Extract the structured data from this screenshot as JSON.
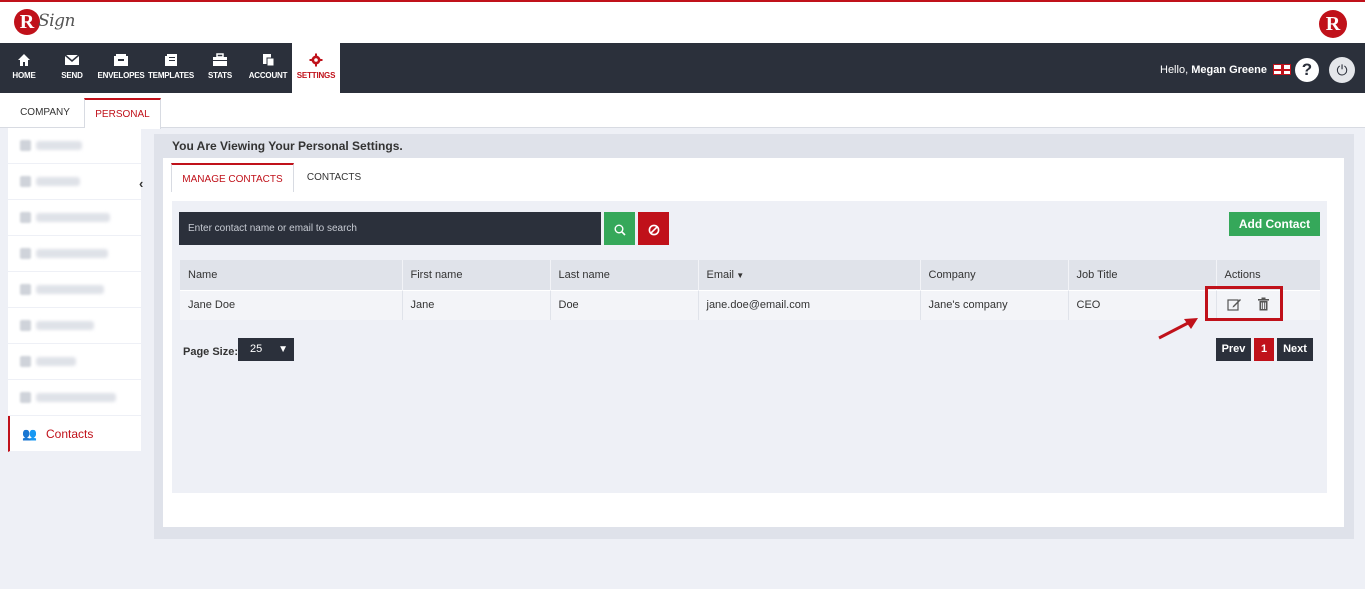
{
  "app": {
    "logo_letter": "R",
    "logo_word": "Sign",
    "right_logo_letter": "R"
  },
  "nav": {
    "items": [
      {
        "label": "HOME",
        "icon": "home-icon"
      },
      {
        "label": "SEND",
        "icon": "envelope-icon"
      },
      {
        "label": "ENVELOPES",
        "icon": "inbox-icon"
      },
      {
        "label": "TEMPLATES",
        "icon": "templates-icon"
      },
      {
        "label": "STATS",
        "icon": "briefcase-icon"
      },
      {
        "label": "ACCOUNT",
        "icon": "account-icon"
      },
      {
        "label": "SETTINGS",
        "icon": "gear-icon"
      }
    ],
    "active": "SETTINGS",
    "hello_prefix": "Hello,",
    "user_name": "Megan Greene",
    "help_glyph": "?",
    "power_glyph": "⏻"
  },
  "settings_tabs": [
    "COMPANY",
    "PERSONAL"
  ],
  "settings_active": "PERSONAL",
  "sidebar": {
    "active_label": "Contacts",
    "blurred_count": 8
  },
  "main": {
    "view_title": "You Are Viewing Your Personal Settings.",
    "tabs": [
      "MANAGE CONTACTS",
      "CONTACTS"
    ],
    "active_tab": "MANAGE CONTACTS",
    "search_placeholder": "Enter contact name or email to search",
    "add_contact_label": "Add Contact",
    "table": {
      "columns": [
        "Name",
        "First name",
        "Last name",
        "Email",
        "Company",
        "Job Title",
        "Actions"
      ],
      "rows": [
        {
          "name": "Jane Doe",
          "first": "Jane",
          "last": "Doe",
          "email": "jane.doe@email.com",
          "company": "Jane's company",
          "job": "CEO"
        }
      ]
    },
    "page_size_label": "Page Size:",
    "page_size_value": "25",
    "pager": {
      "prev": "Prev",
      "current": "1",
      "next": "Next"
    }
  },
  "colors": {
    "brand_red": "#c0111a",
    "dark": "#2b303b",
    "green": "#35a85a"
  }
}
